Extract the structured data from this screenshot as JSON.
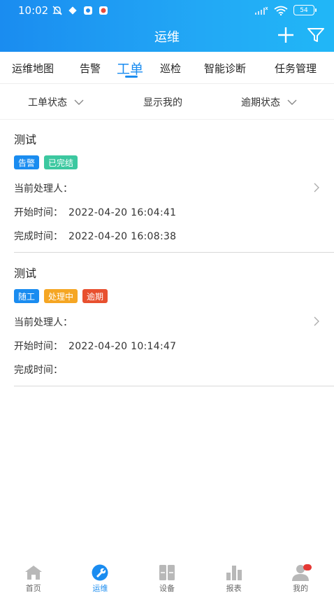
{
  "status_bar": {
    "time": "10:02",
    "battery": "54"
  },
  "header": {
    "title": "运维"
  },
  "tabs": [
    {
      "label": "运维地图"
    },
    {
      "label": "告警"
    },
    {
      "label": "工单"
    },
    {
      "label": "巡检"
    },
    {
      "label": "智能诊断"
    },
    {
      "label": "任务管理"
    }
  ],
  "active_tab": "工单",
  "filters": [
    {
      "label": "工单状态"
    },
    {
      "label": "显示我的"
    },
    {
      "label": "逾期状态"
    }
  ],
  "orders": [
    {
      "title": "测试",
      "badges": [
        {
          "label": "告警",
          "color": "#1a8cf0"
        },
        {
          "label": "已完结",
          "color": "#3cc8a0"
        }
      ],
      "handler_label": "当前处理人：",
      "handler": "",
      "start_label": "开始时间：",
      "start": "2022-04-20 16:04:41",
      "finish_label": "完成时间：",
      "finish": "2022-04-20 16:08:38"
    },
    {
      "title": "测试",
      "badges": [
        {
          "label": "随工",
          "color": "#1a8cf0"
        },
        {
          "label": "处理中",
          "color": "#f5a623"
        },
        {
          "label": "逾期",
          "color": "#e8502f"
        }
      ],
      "handler_label": "当前处理人：",
      "handler": "",
      "start_label": "开始时间：",
      "start": "2022-04-20 10:14:47",
      "finish_label": "完成时间：",
      "finish": ""
    }
  ],
  "bottom_nav": [
    {
      "label": "首页",
      "icon": "home-icon"
    },
    {
      "label": "运维",
      "icon": "wrench-icon"
    },
    {
      "label": "设备",
      "icon": "device-icon"
    },
    {
      "label": "报表",
      "icon": "chart-icon"
    },
    {
      "label": "我的",
      "icon": "user-icon"
    }
  ],
  "colors": {
    "accent": "#1a8cf0",
    "notification_dot": "#e53935"
  }
}
